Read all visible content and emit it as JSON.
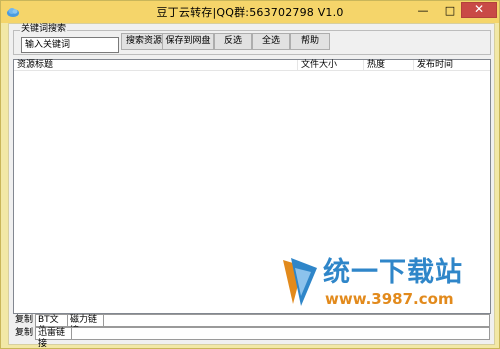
{
  "window": {
    "title": "豆丁云转存|QQ群:563702798  V1.0",
    "minimize_symbol": "—",
    "maximize_symbol": "□",
    "close_symbol": "✕"
  },
  "search_group": {
    "legend": "关键词搜索",
    "input_value": "输入关键词",
    "buttons": {
      "search": "搜索资源",
      "save_to_disk": "保存到网盘",
      "invert": "反选",
      "select_all": "全选",
      "help": "帮助"
    }
  },
  "results_table": {
    "columns": [
      "资源标题",
      "文件大小",
      "热度",
      "发布时间"
    ],
    "rows": []
  },
  "watermark": {
    "title": "统一下载站",
    "url": "www.3987.com"
  },
  "bottom_rows": [
    {
      "copy_label": "复制",
      "tabs": [
        "BT文件",
        "磁力链接"
      ]
    },
    {
      "copy_label": "复制",
      "tabs": [
        "迅雷链接"
      ]
    }
  ],
  "icons": {
    "app": "cloud-icon",
    "watermark_logo": "download-site-logo-icon"
  },
  "colors": {
    "titlebar": "#f5d56a",
    "frame": "#f2e8a6",
    "close_button": "#c94a46",
    "watermark_blue": "#2f86c9",
    "watermark_orange": "#e28a1c"
  }
}
